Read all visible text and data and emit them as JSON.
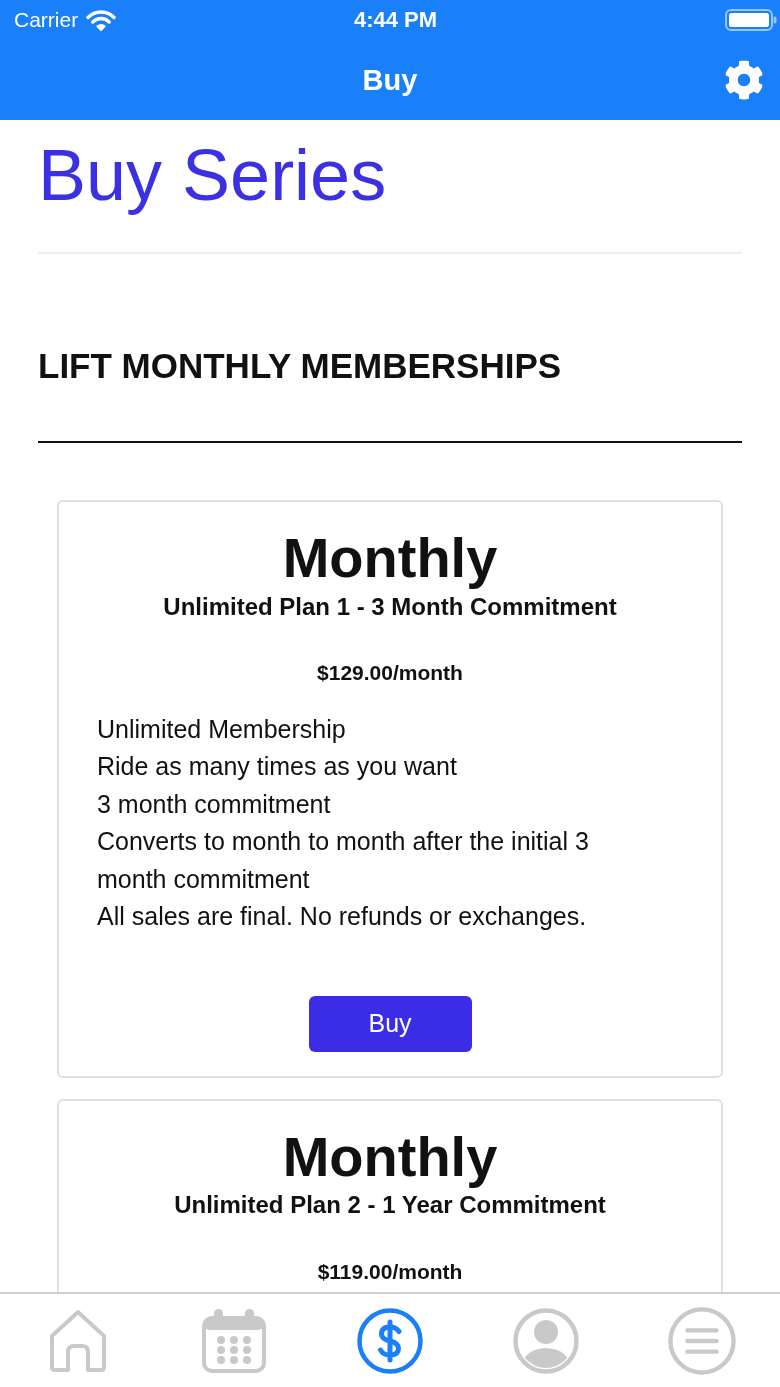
{
  "status_bar": {
    "carrier": "Carrier",
    "time": "4:44 PM"
  },
  "nav_bar": {
    "title": "Buy"
  },
  "page": {
    "title": "Buy Series",
    "section_heading": "LIFT MONTHLY MEMBERSHIPS"
  },
  "plans": [
    {
      "name": "Monthly",
      "subtitle": "Unlimited Plan 1 - 3 Month Commitment",
      "price": "$129.00/month",
      "features": [
        "Unlimited Membership",
        "Ride as many times as you want",
        "3 month commitment",
        "Converts to month to month after the initial 3 month commitment",
        "All sales are final. No refunds or exchanges."
      ],
      "button": "Buy"
    },
    {
      "name": "Monthly",
      "subtitle": "Unlimited Plan 2 - 1 Year Commitment",
      "price": "$119.00/month"
    }
  ],
  "tab_bar": [
    {
      "kind": "home",
      "selected": false
    },
    {
      "kind": "calendar",
      "selected": false
    },
    {
      "kind": "payments",
      "selected": true
    },
    {
      "kind": "profile",
      "selected": false
    },
    {
      "kind": "menu",
      "selected": false
    }
  ]
}
